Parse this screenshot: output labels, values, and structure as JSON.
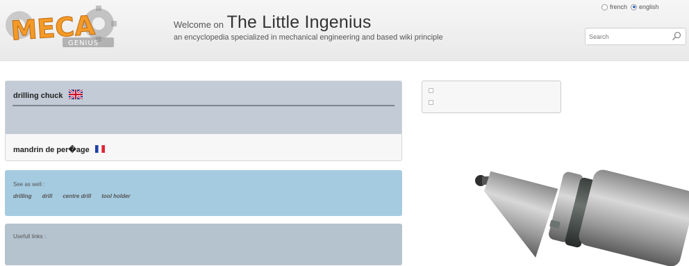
{
  "header": {
    "logo_text": "MECA",
    "logo_subtext": "GENIUS",
    "welcome_prefix": "Welcome on",
    "site_title": "The Little Ingenius",
    "tagline": "an encyclopedia specialized in mechanical engineering and based wiki principle"
  },
  "language": {
    "options": [
      "french",
      "english"
    ],
    "selected": "english"
  },
  "search": {
    "placeholder": "Search"
  },
  "term": {
    "english": "drilling chuck",
    "french": "mandrin de per�age"
  },
  "see_also": {
    "title": "See as well :",
    "links": [
      "drilling",
      "drill",
      "centre drill",
      "tool holder"
    ]
  },
  "useful_links": {
    "title": "Usefull links :"
  },
  "icons": {
    "search": "magnifier-icon",
    "flag_en": "uk-flag-icon",
    "flag_fr": "france-flag-icon",
    "broken_image": "broken-image-icon"
  },
  "colors": {
    "term_panel": "#c2cbd6",
    "see_also_panel": "#a5cbe0",
    "useful_panel": "#b5c3ce"
  }
}
